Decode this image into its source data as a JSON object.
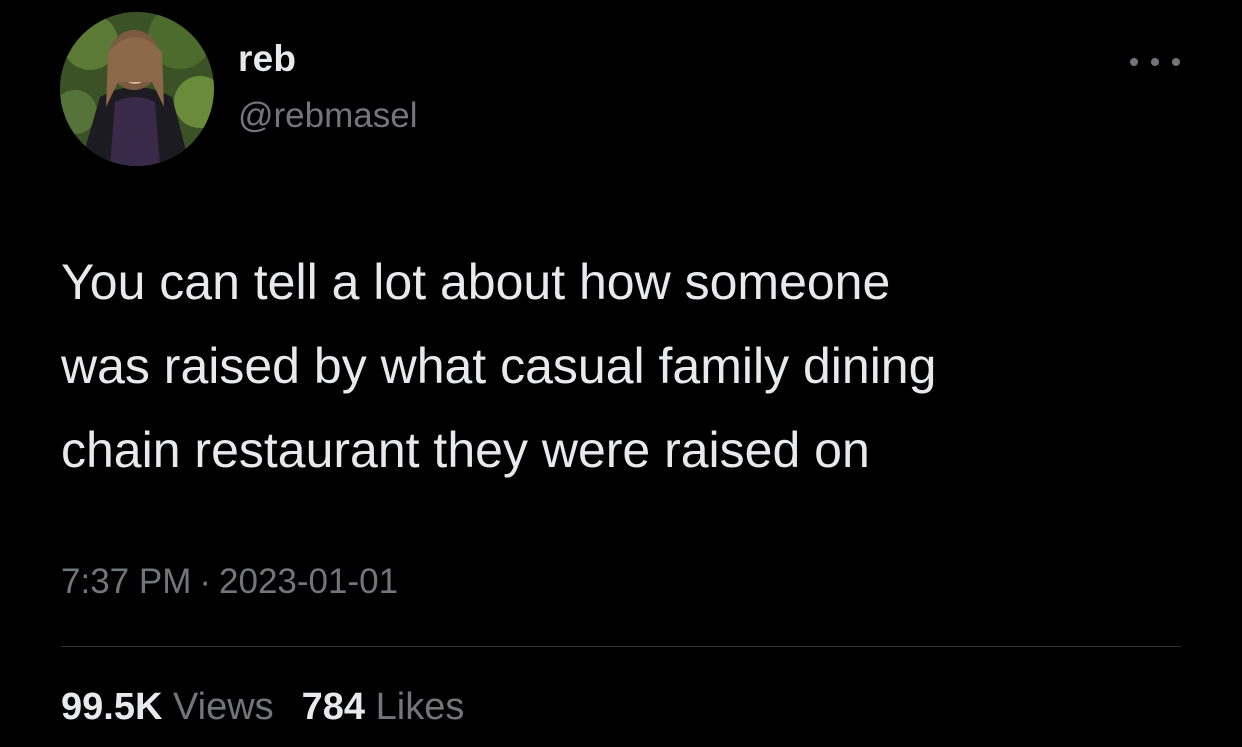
{
  "author": {
    "display_name": "reb",
    "handle": "@rebmasel",
    "avatar_icon": "profile-photo"
  },
  "menu_icon": "more-horizontal-icon",
  "tweet": {
    "lines": [
      "You can tell a lot about how someone",
      "was raised by what casual family dining",
      "chain restaurant they were raised on"
    ],
    "time": "7:37 PM",
    "separator": "·",
    "date": "2023-01-01"
  },
  "stats": {
    "views_count": "99.5K",
    "views_label": "Views",
    "likes_count": "784",
    "likes_label": "Likes"
  },
  "colors": {
    "background": "#000000",
    "primary_text": "#e7e9ea",
    "secondary_text": "#71767b",
    "divider": "#2f3336"
  }
}
